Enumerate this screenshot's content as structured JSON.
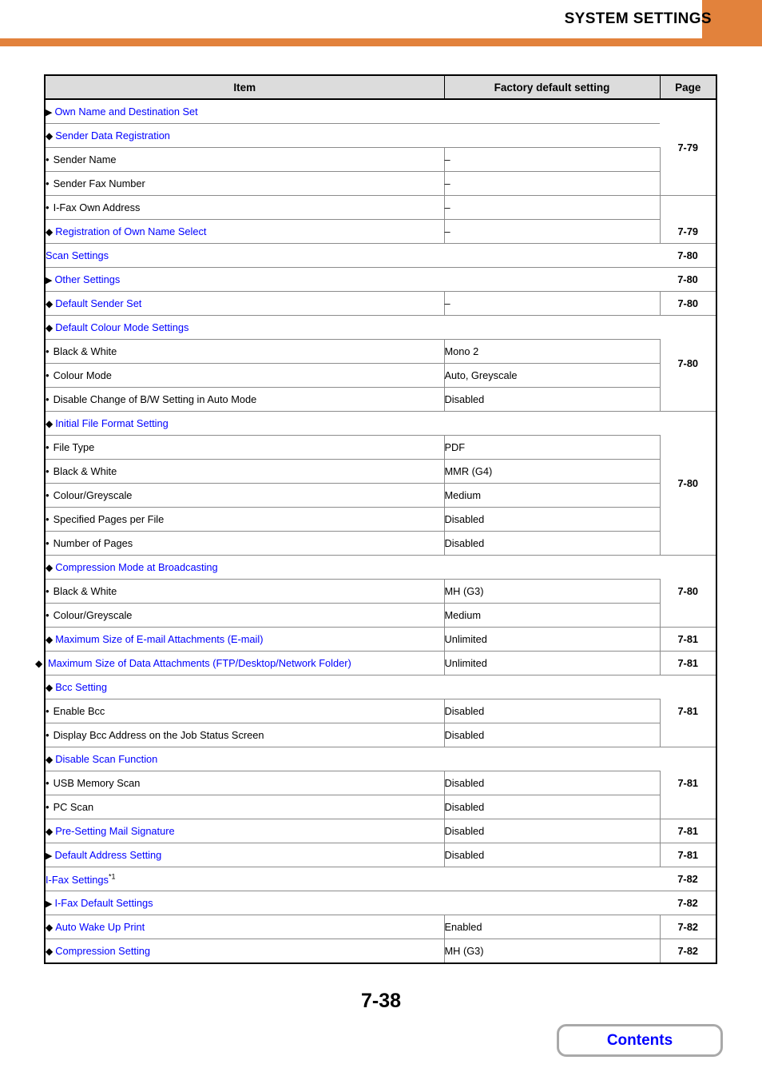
{
  "header": {
    "title": "SYSTEM SETTINGS",
    "accent_color": "#e2823c"
  },
  "link_color": "#0000ff",
  "table": {
    "columns": {
      "item": "Item",
      "default": "Factory default setting",
      "page": "Page"
    },
    "rows": [
      {
        "level": 1,
        "marker": "triangle",
        "item": "Own Name and Destination Set",
        "link": true,
        "default": "",
        "span_item": true,
        "page": "7-79",
        "page_rowspan": 4
      },
      {
        "level": 2,
        "marker": "diamond",
        "item": "Sender Data Registration",
        "link": true,
        "default": "",
        "span_item": true
      },
      {
        "level": 3,
        "marker": "bullet",
        "item": "Sender Name",
        "link": false,
        "default": "–"
      },
      {
        "level": 3,
        "marker": "bullet",
        "item": "Sender Fax Number",
        "link": false,
        "default": "–"
      },
      {
        "level": 3,
        "marker": "bullet",
        "item": "I-Fax Own Address",
        "link": false,
        "default": "–"
      },
      {
        "level": 2,
        "marker": "diamond",
        "item": "Registration of Own Name Select",
        "link": true,
        "default": "–",
        "page": "7-79",
        "page_rowspan": 1
      },
      {
        "level": 0,
        "marker": "none",
        "item": "Scan Settings",
        "link": true,
        "default": "",
        "span_item": true,
        "page": "7-80",
        "page_rowspan": 1
      },
      {
        "level": 1,
        "marker": "triangle",
        "item": "Other Settings",
        "link": true,
        "default": "",
        "span_item": true,
        "page": "7-80",
        "page_rowspan": 1
      },
      {
        "level": 2,
        "marker": "diamond",
        "item": "Default Sender Set",
        "link": true,
        "default": "–",
        "page": "7-80",
        "page_rowspan": 1
      },
      {
        "level": 2,
        "marker": "diamond",
        "item": "Default Colour Mode Settings",
        "link": true,
        "default": "",
        "span_item": true,
        "page": "7-80",
        "page_rowspan": 4
      },
      {
        "level": 3,
        "marker": "bullet",
        "item": "Black & White",
        "link": false,
        "default": "Mono 2"
      },
      {
        "level": 3,
        "marker": "bullet",
        "item": "Colour Mode",
        "link": false,
        "default": "Auto, Greyscale"
      },
      {
        "level": 3,
        "marker": "bullet",
        "item": "Disable Change of B/W Setting in Auto Mode",
        "link": false,
        "default": "Disabled"
      },
      {
        "level": 2,
        "marker": "diamond",
        "item": "Initial File Format Setting",
        "link": true,
        "default": "",
        "span_item": true,
        "page": "7-80",
        "page_rowspan": 6
      },
      {
        "level": 3,
        "marker": "bullet",
        "item": "File Type",
        "link": false,
        "default": "PDF"
      },
      {
        "level": 3,
        "marker": "bullet",
        "item": "Black & White",
        "link": false,
        "default": "MMR (G4)"
      },
      {
        "level": 3,
        "marker": "bullet",
        "item": "Colour/Greyscale",
        "link": false,
        "default": "Medium"
      },
      {
        "level": 3,
        "marker": "bullet",
        "item": "Specified Pages per File",
        "link": false,
        "default": "Disabled"
      },
      {
        "level": 3,
        "marker": "bullet",
        "item": "Number of Pages",
        "link": false,
        "default": "Disabled"
      },
      {
        "level": 2,
        "marker": "diamond",
        "item": "Compression Mode at Broadcasting",
        "link": true,
        "default": "",
        "span_item": true,
        "page": "7-80",
        "page_rowspan": 3
      },
      {
        "level": 3,
        "marker": "bullet",
        "item": "Black & White",
        "link": false,
        "default": "MH (G3)"
      },
      {
        "level": 3,
        "marker": "bullet",
        "item": "Colour/Greyscale",
        "link": false,
        "default": "Medium"
      },
      {
        "level": 2,
        "marker": "diamond",
        "item": "Maximum Size of E-mail Attachments (E-mail)",
        "link": true,
        "default": "Unlimited",
        "page": "7-81",
        "page_rowspan": 1
      },
      {
        "level": 2,
        "marker": "diamond",
        "item": "Maximum Size of Data Attachments (FTP/Desktop/Network Folder)",
        "link": true,
        "default": "Unlimited",
        "page": "7-81",
        "page_rowspan": 1,
        "two_line": true
      },
      {
        "level": 2,
        "marker": "diamond",
        "item": "Bcc Setting",
        "link": true,
        "default": "",
        "span_item": true,
        "page": "7-81",
        "page_rowspan": 3
      },
      {
        "level": 3,
        "marker": "bullet",
        "item": "Enable Bcc",
        "link": false,
        "default": "Disabled"
      },
      {
        "level": 3,
        "marker": "bullet",
        "item": "Display Bcc Address on the Job Status Screen",
        "link": false,
        "default": "Disabled"
      },
      {
        "level": 2,
        "marker": "diamond",
        "item": "Disable Scan Function",
        "link": true,
        "default": "",
        "span_item": true,
        "page": "7-81",
        "page_rowspan": 3
      },
      {
        "level": 3,
        "marker": "bullet",
        "item": "USB Memory Scan",
        "link": false,
        "default": "Disabled"
      },
      {
        "level": 3,
        "marker": "bullet",
        "item": "PC Scan",
        "link": false,
        "default": "Disabled"
      },
      {
        "level": 2,
        "marker": "diamond",
        "item": "Pre-Setting Mail Signature",
        "link": true,
        "default": "Disabled",
        "page": "7-81",
        "page_rowspan": 1
      },
      {
        "level": 1,
        "marker": "triangle",
        "item": "Default Address Setting",
        "link": true,
        "default": "Disabled",
        "page": "7-81",
        "page_rowspan": 1
      },
      {
        "level": 0,
        "marker": "none",
        "item": "I-Fax Settings",
        "superscript": "*1",
        "link": true,
        "default": "",
        "span_item": true,
        "page": "7-82",
        "page_rowspan": 1
      },
      {
        "level": 1,
        "marker": "triangle",
        "item": "I-Fax Default Settings",
        "link": true,
        "default": "",
        "span_item": true,
        "page": "7-82",
        "page_rowspan": 1
      },
      {
        "level": 2,
        "marker": "diamond",
        "item": "Auto Wake Up Print",
        "link": true,
        "default": "Enabled",
        "page": "7-82",
        "page_rowspan": 1
      },
      {
        "level": 2,
        "marker": "diamond",
        "item": "Compression Setting",
        "link": true,
        "default": "MH (G3)",
        "page": "7-82",
        "page_rowspan": 1
      }
    ]
  },
  "footer": {
    "page_number": "7-38",
    "contents_label": "Contents"
  }
}
